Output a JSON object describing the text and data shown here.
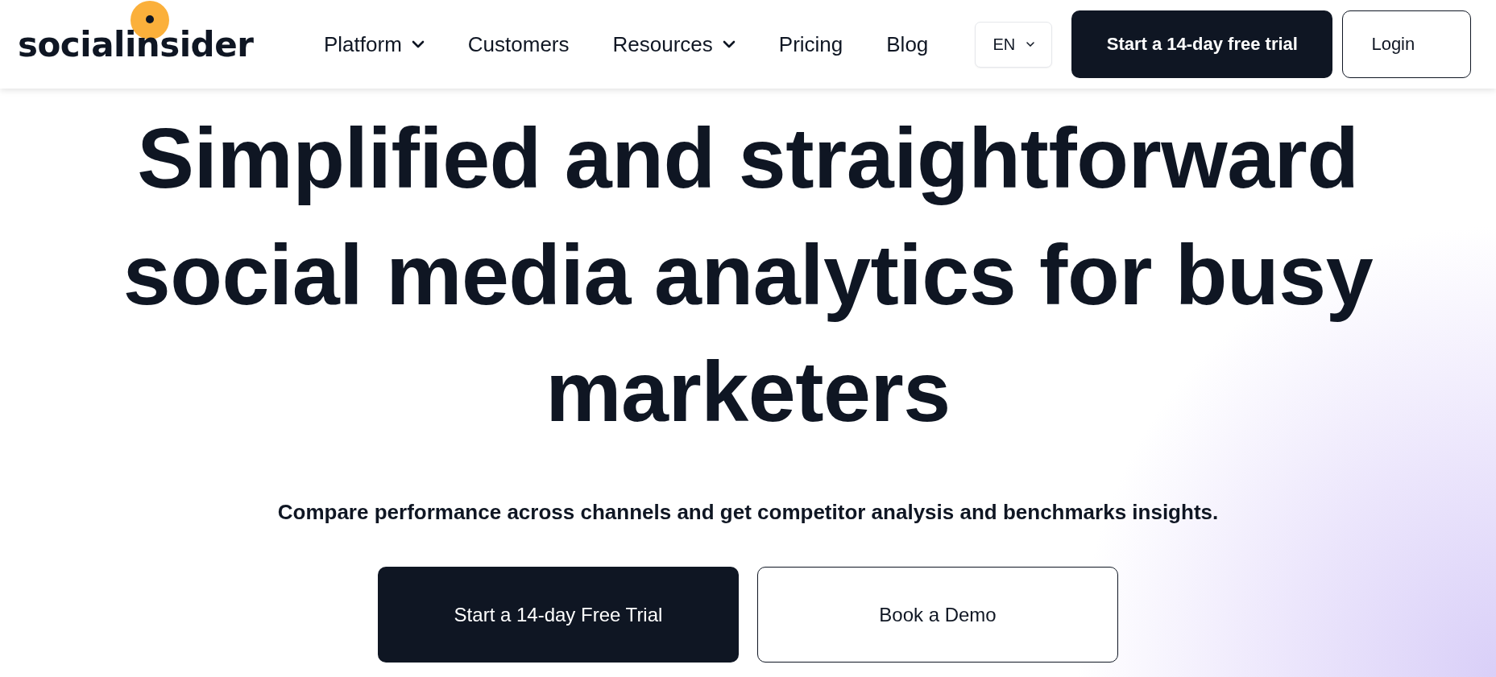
{
  "logo": {
    "text": "socialinsider"
  },
  "nav": [
    {
      "label": "Platform",
      "has_menu": true
    },
    {
      "label": "Customers",
      "has_menu": false
    },
    {
      "label": "Resources",
      "has_menu": true
    },
    {
      "label": "Pricing",
      "has_menu": false
    },
    {
      "label": "Blog",
      "has_menu": false
    }
  ],
  "language": {
    "label": "EN"
  },
  "header_buttons": [
    {
      "label": "Start a 14-day free trial",
      "kind": "primary"
    },
    {
      "label": "Login",
      "kind": "outline"
    }
  ],
  "hero": {
    "headline": "Simplified and straightforward social media analytics for busy marketers",
    "subtitle": "Compare performance across channels and get competitor analysis and benchmarks insights.",
    "buttons": [
      {
        "label": "Start a 14-day Free Trial",
        "kind": "primary"
      },
      {
        "label": "Book a Demo",
        "kind": "outline"
      }
    ]
  }
}
